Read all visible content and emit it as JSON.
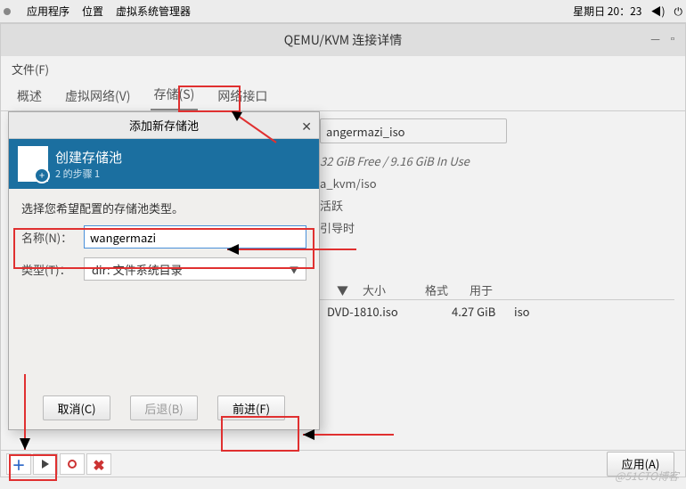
{
  "menubar": {
    "apps": "应用程序",
    "places": "位置",
    "vmm": "虚拟系统管理器",
    "clock": "星期日 20：23"
  },
  "window": {
    "title": "QEMU/KVM 连接详情",
    "file_menu": "文件(F)",
    "tabs": {
      "overview": "概述",
      "vnet": "虚拟网络(V)",
      "storage": "存储(S)",
      "netif": "网络接口"
    }
  },
  "pool": {
    "name_visible": "angermazi_iso",
    "free_line_a": "32 GiB Free",
    "free_line_b": "/ 9.16 GiB In Use",
    "path": "a_kvm/iso",
    "state_label": "活跃",
    "boot_label": "引导时"
  },
  "table": {
    "hdr_sort": "▼",
    "hdr_size": "大小",
    "hdr_format": "格式",
    "hdr_used": "用于",
    "row_name": "DVD-1810.iso",
    "row_size": "4.27 GiB",
    "row_fmt": "iso"
  },
  "dialog": {
    "title": "添加新存储池",
    "banner_title": "创建存储池",
    "banner_step": "2 的步骤 1",
    "prompt": "选择您希望配置的存储池类型。",
    "name_label": "名称(N)：",
    "name_value": "wangermazi",
    "type_label": "类型(T)：",
    "type_value": "dir: 文件系统目录",
    "btn_cancel": "取消(C)",
    "btn_back": "后退(B)",
    "btn_forward": "前进(F)"
  },
  "bottom": {
    "apply": "应用(A)"
  },
  "watermark": "@51CTO博客"
}
